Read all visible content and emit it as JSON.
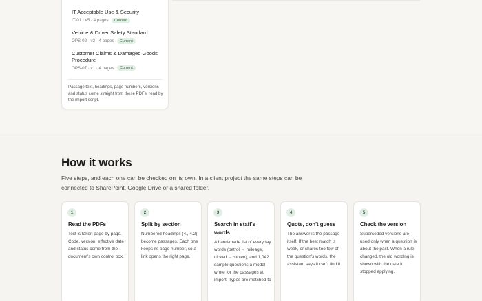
{
  "documents": [
    {
      "title": "IT Acceptable Use & Security",
      "meta": "IT-01 · v5 · 4 pages",
      "status": "Current"
    },
    {
      "title": "Vehicle & Driver Safety Standard",
      "meta": "OPS-02 · v2 · 4 pages",
      "status": "Current"
    },
    {
      "title": "Customer Claims & Damaged Goods Procedure",
      "meta": "OPS-07 · v1 · 4 pages",
      "status": "Current"
    }
  ],
  "card_note": "Passage text, headings, page numbers, versions and status come straight from these PDFs, read by the import script.",
  "how": {
    "title": "How it works",
    "subtitle": "Five steps, and each one can be checked on its own. In a client project the same steps can be connected to SharePoint, Google Drive or a shared folder.",
    "steps": [
      {
        "num": "1",
        "title": "Read the PDFs",
        "body": "Text is taken page by page. Code, version, effective date and status come from the document's own control box."
      },
      {
        "num": "2",
        "title": "Split by section",
        "body": "Numbered headings (4., 4.2) become passages. Each one keeps its page number, so a link opens the right page."
      },
      {
        "num": "3",
        "title": "Search in staff's words",
        "body": "A hand-made list of everyday words (petrol → mileage, nicked → stolen), and 1,042 sample questions a model wrote for the passages at import. Typos are matched to"
      },
      {
        "num": "4",
        "title": "Quote, don't guess",
        "body": "The answer is the passage itself. If the best match is weak, or shares too few of the question's words, the assistant says it can't find it."
      },
      {
        "num": "5",
        "title": "Check the version",
        "body": "Superseded versions are used only when a question is about the past. When a rule changed, the old wording is shown with the date it stopped applying."
      }
    ]
  },
  "colors": {
    "accent": "#3f6a4c",
    "badge_bg": "#e3efe6",
    "page_bg": "#f7f6f3"
  }
}
